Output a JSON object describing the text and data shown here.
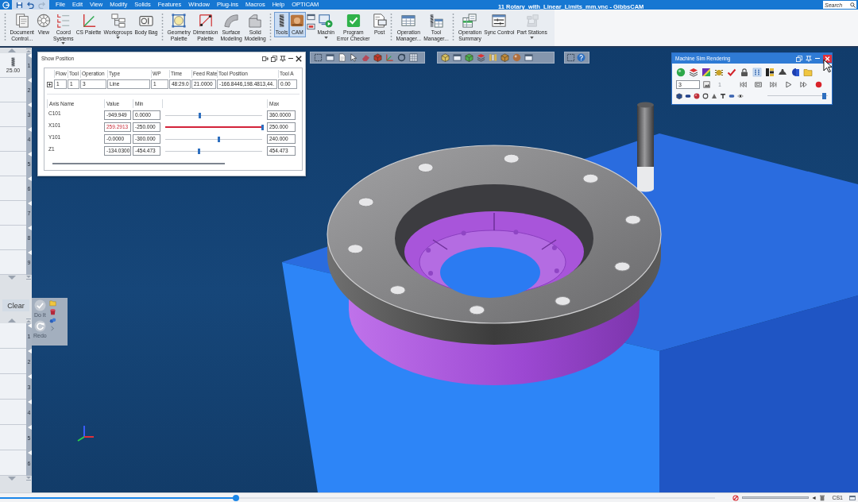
{
  "title_bar": {
    "quick_access": [
      {
        "kind": "save",
        "disabled": false
      },
      {
        "kind": "undo",
        "disabled": false
      },
      {
        "kind": "redo",
        "disabled": true
      }
    ],
    "menus": [
      "File",
      "Edit",
      "View",
      "Modify",
      "Solids",
      "Features",
      "Window",
      "Plug-ins",
      "Macros",
      "Help",
      "OPTICAM"
    ],
    "title": "11 Rotary_with_Linear_Limits_mm.vnc - GibbsCAM",
    "search": {
      "placeholder": "Search"
    }
  },
  "ribbon": {
    "groups": [
      {
        "buttons": [
          {
            "kind": "document",
            "label": "Document\nControl...",
            "dropdown": false,
            "selected": false,
            "disabled": false
          },
          {
            "kind": "view",
            "label": "View",
            "dropdown": false,
            "selected": false,
            "disabled": false
          },
          {
            "kind": "coord",
            "label": "Coord\nSystems",
            "dropdown": true,
            "selected": false,
            "disabled": false
          },
          {
            "kind": "cs_palette",
            "label": "CS Palette",
            "dropdown": false,
            "selected": false,
            "disabled": false
          },
          {
            "kind": "workgroups",
            "label": "Workgroups",
            "dropdown": true,
            "selected": false,
            "disabled": false
          },
          {
            "kind": "body_bag",
            "label": "Body Bag",
            "dropdown": false,
            "selected": false,
            "disabled": false
          }
        ]
      },
      {
        "buttons": [
          {
            "kind": "geometry",
            "label": "Geometry\nPalette",
            "dropdown": false,
            "selected": false,
            "disabled": false
          },
          {
            "kind": "dimension",
            "label": "Dimension\nPalette",
            "dropdown": false,
            "selected": false,
            "disabled": false
          },
          {
            "kind": "surface",
            "label": "Surface\nModeling",
            "dropdown": false,
            "selected": false,
            "disabled": false
          },
          {
            "kind": "solid",
            "label": "Solid\nModeling",
            "dropdown": false,
            "selected": false,
            "disabled": false
          }
        ]
      },
      {
        "buttons": [
          {
            "kind": "tools",
            "label": "Tools",
            "dropdown": false,
            "selected": true,
            "disabled": false
          },
          {
            "kind": "cam",
            "label": "CAM",
            "dropdown": false,
            "selected": true,
            "disabled": false
          },
          {
            "kind": "mini"
          },
          {
            "kind": "machine",
            "label": "Machin",
            "dropdown": true,
            "selected": false,
            "disabled": false
          },
          {
            "kind": "checker",
            "label": "Program\nError Checker",
            "dropdown": false,
            "disabled": false
          },
          {
            "kind": "post",
            "label": "Post",
            "dropdown": false,
            "disabled": false
          }
        ]
      },
      {
        "buttons": [
          {
            "kind": "opman",
            "label": "Operation\nManager...",
            "dropdown": false,
            "selected": false,
            "disabled": false
          },
          {
            "kind": "toolman",
            "label": "Tool\nManager...",
            "dropdown": false,
            "selected": false,
            "disabled": false
          }
        ]
      },
      {
        "buttons": [
          {
            "kind": "opsum",
            "label": "Operation\nSummary",
            "dropdown": false,
            "selected": false,
            "disabled": false
          },
          {
            "kind": "sync",
            "label": "Sync Control",
            "dropdown": false,
            "selected": false,
            "disabled": false
          },
          {
            "kind": "stations",
            "label": "Part Stations",
            "dropdown": true,
            "selected": false,
            "disabled": true
          }
        ]
      }
    ]
  },
  "tool_list": {
    "items": [
      {
        "number": "1",
        "kind": "drill",
        "label": "25.00"
      },
      {
        "number": "2",
        "kind": "empty"
      },
      {
        "number": "3",
        "kind": "empty"
      },
      {
        "number": "4",
        "kind": "empty"
      },
      {
        "number": "5",
        "kind": "empty"
      },
      {
        "number": "6",
        "kind": "empty"
      },
      {
        "number": "7",
        "kind": "empty"
      },
      {
        "number": "8",
        "kind": "empty"
      },
      {
        "number": "9",
        "kind": "empty"
      }
    ]
  },
  "show_position": {
    "title": "Show Position",
    "flow_table": {
      "columns": [
        "Flow",
        "Tool",
        "Operation",
        "Type",
        "WP",
        "Time",
        "Feed Rate",
        "Tool Position",
        "Tool A"
      ],
      "rows": [
        {
          "expanded": false,
          "cells": [
            "1",
            "1",
            "3",
            "Line",
            "1",
            "48:29.0",
            "21.0000",
            "-166.8446,198.4813,44.",
            "0.00"
          ]
        }
      ]
    },
    "axes_table": {
      "columns": [
        "Axis Name",
        "Value",
        "Min",
        "Max"
      ],
      "rows": [
        {
          "name": "C101",
          "value": "-949.949",
          "min": "0.0000",
          "level": 0.36,
          "max": "360.0000",
          "over_limit": false
        },
        {
          "name": "X101",
          "value": "259.2913",
          "min": "-250.000",
          "level": 1,
          "max": "250.000",
          "over_limit": true
        },
        {
          "name": "Y101",
          "value": "-0.0000",
          "min": "-300.000",
          "level": 0.55,
          "max": "240.000",
          "over_limit": false
        },
        {
          "name": "Z1",
          "value": "-134.0300",
          "min": "-454.473",
          "level": 0.35,
          "max": "454.473",
          "over_limit": false
        }
      ]
    }
  },
  "machine_sim": {
    "title": "Machine Sim Rendering",
    "step_field": {
      "value": "3"
    },
    "count_field": {
      "value": "1",
      "disabled": true
    },
    "speed_slider": {
      "level": 0.94
    }
  },
  "clear_button": {
    "label": "Clear"
  },
  "process_palette": {
    "buttons": [
      {
        "kind": "do_it",
        "label": "Do It",
        "disabled": true
      },
      {
        "kind": "redo",
        "label": "Redo",
        "disabled": true
      }
    ]
  },
  "process_list": {
    "items": [
      {
        "number": "1"
      },
      {
        "number": "2"
      },
      {
        "number": "3"
      },
      {
        "number": "4"
      },
      {
        "number": "5"
      },
      {
        "number": "6"
      }
    ]
  },
  "status_bar": {
    "progress": {
      "level": 0.33
    },
    "coord_system": "CS1"
  }
}
